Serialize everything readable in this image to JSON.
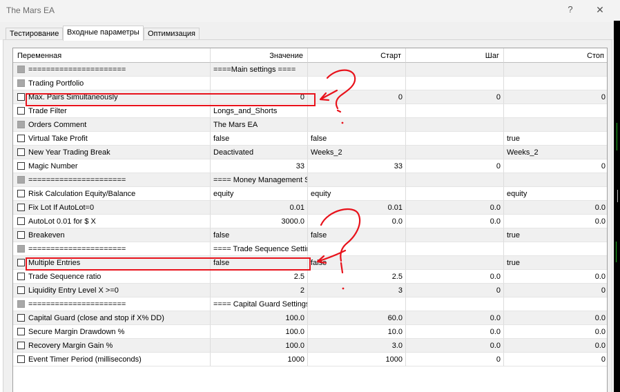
{
  "window": {
    "title": "The Mars EA",
    "help": "?",
    "close": "✕"
  },
  "tabs": [
    "Тестирование",
    "Входные параметры",
    "Оптимизация"
  ],
  "columns": [
    "Переменная",
    "Значение",
    "Старт",
    "Шаг",
    "Стоп"
  ],
  "rows": [
    {
      "name": "======================",
      "value": "====Main settings ====",
      "start": "",
      "step": "",
      "stop": "",
      "disabled": true
    },
    {
      "name": "Trading Portfolio",
      "value": "",
      "start": "",
      "step": "",
      "stop": "",
      "disabled": true
    },
    {
      "name": "Max. Pairs Simultaneously",
      "value": "0",
      "start": "0",
      "step": "0",
      "stop": "0",
      "disabled": false
    },
    {
      "name": "Trade Filter",
      "value": "Longs_and_Shorts",
      "start": "",
      "step": "",
      "stop": "",
      "disabled": false
    },
    {
      "name": "Orders Comment",
      "value": "The Mars EA",
      "start": "",
      "step": "",
      "stop": "",
      "disabled": true
    },
    {
      "name": "Virtual Take Profit",
      "value": "false",
      "start": "false",
      "step": "",
      "stop": "true",
      "disabled": false
    },
    {
      "name": "New Year Trading Break",
      "value": "Deactivated",
      "start": "Weeks_2",
      "step": "",
      "stop": "Weeks_2",
      "disabled": false
    },
    {
      "name": "Magic Number",
      "value": "33",
      "start": "33",
      "step": "0",
      "stop": "0",
      "disabled": false
    },
    {
      "name": "======================",
      "value": "==== Money Management Settings ====",
      "start": "",
      "step": "",
      "stop": "",
      "disabled": true
    },
    {
      "name": "Risk Calculation Equity/Balance",
      "value": "equity",
      "start": "equity",
      "step": "",
      "stop": "equity",
      "disabled": false
    },
    {
      "name": "Fix Lot If AutoLot=0",
      "value": "0.01",
      "start": "0.01",
      "step": "0.0",
      "stop": "0.0",
      "disabled": false
    },
    {
      "name": "AutoLot 0.01 for $ X",
      "value": "3000.0",
      "start": "0.0",
      "step": "0.0",
      "stop": "0.0",
      "disabled": false
    },
    {
      "name": "Breakeven",
      "value": "false",
      "start": "false",
      "step": "",
      "stop": "true",
      "disabled": false
    },
    {
      "name": "======================",
      "value": "==== Trade Sequence Settings ====",
      "start": "",
      "step": "",
      "stop": "",
      "disabled": true
    },
    {
      "name": "Multiple Entries",
      "value": "false",
      "start": "false",
      "step": "",
      "stop": "true",
      "disabled": false
    },
    {
      "name": "Trade Sequence ratio",
      "value": "2.5",
      "start": "2.5",
      "step": "0.0",
      "stop": "0.0",
      "disabled": false
    },
    {
      "name": "Liquidity Entry Level X >=0",
      "value": "2",
      "start": "3",
      "step": "0",
      "stop": "0",
      "disabled": false
    },
    {
      "name": "======================",
      "value": "==== Capital Guard Settings ====",
      "start": "",
      "step": "",
      "stop": "",
      "disabled": true
    },
    {
      "name": "Capital Guard (close and stop if X% DD)",
      "value": "100.0",
      "start": "60.0",
      "step": "0.0",
      "stop": "0.0",
      "disabled": false
    },
    {
      "name": "Secure Margin Drawdown %",
      "value": "100.0",
      "start": "10.0",
      "step": "0.0",
      "stop": "0.0",
      "disabled": false
    },
    {
      "name": "Recovery Margin Gain %",
      "value": "100.0",
      "start": "3.0",
      "step": "0.0",
      "stop": "0.0",
      "disabled": false
    },
    {
      "name": "Event Timer Period (milliseconds)",
      "value": "1000",
      "start": "1000",
      "step": "0",
      "stop": "0",
      "disabled": false
    }
  ],
  "annotation_color": "#e8121b",
  "icons": {
    "checkbox": "checkbox-icon",
    "disabled_checkbox": "disabled-checkbox-icon"
  }
}
